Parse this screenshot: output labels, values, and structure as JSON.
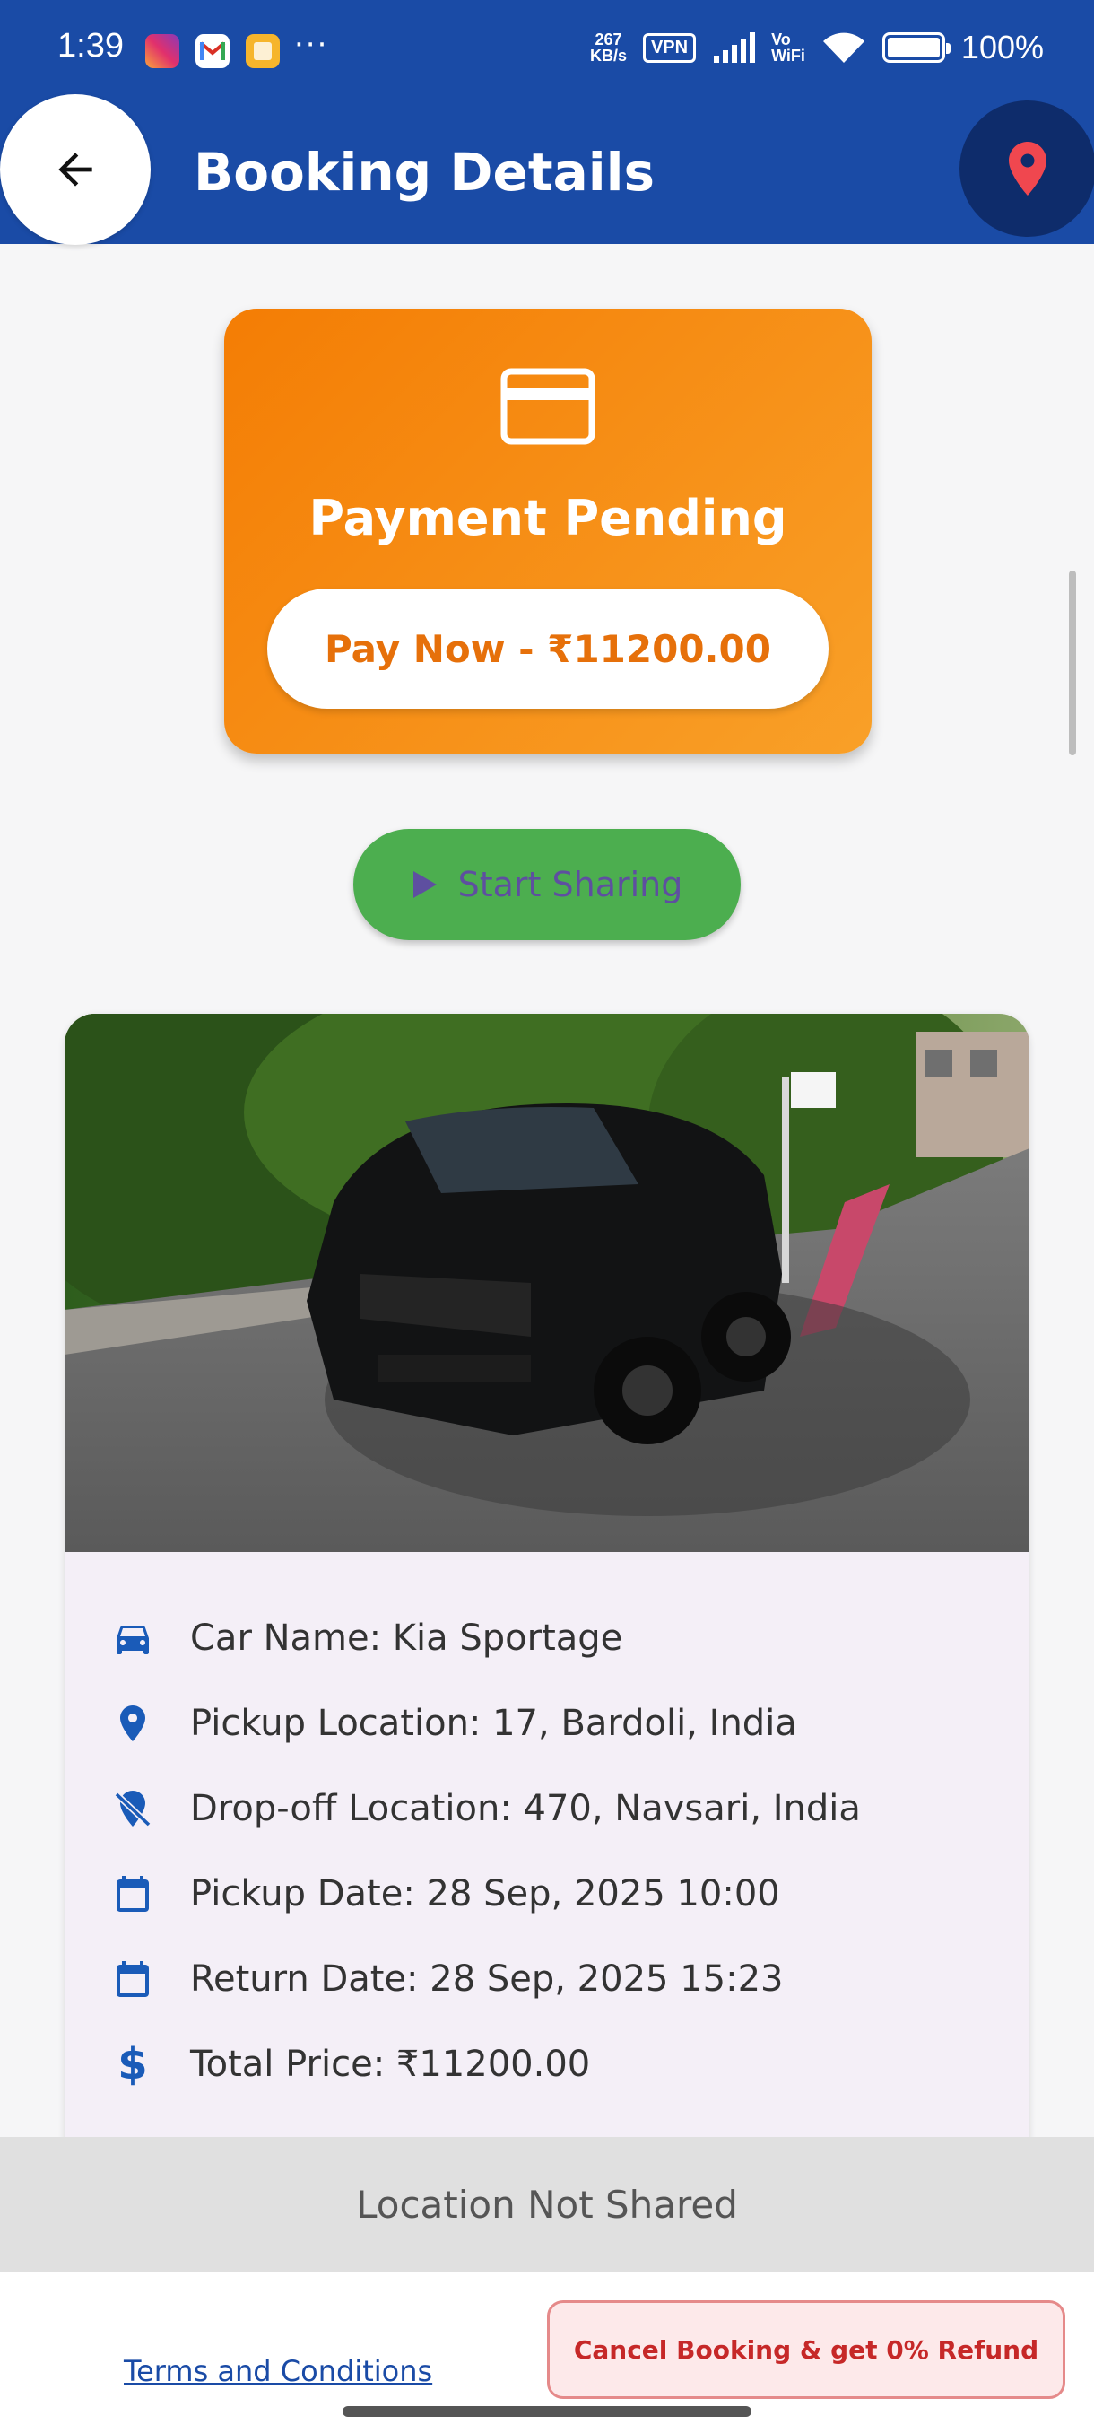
{
  "status_bar": {
    "time": "1:39",
    "more": "···",
    "net_speed_value": "267",
    "net_speed_unit": "KB/s",
    "vpn": "VPN",
    "vowifi_top": "Vo",
    "vowifi_bottom": "WiFi",
    "battery": "100%"
  },
  "header": {
    "title": "Booking Details",
    "color": "#1a4ba6",
    "location_pin_color": "#f0474f"
  },
  "payment": {
    "title": "Payment Pending",
    "button_label": "Pay Now - ₹11200.00"
  },
  "share": {
    "label": "Start Sharing"
  },
  "car": {
    "details": [
      {
        "icon": "car-icon",
        "text": "Car Name: Kia Sportage"
      },
      {
        "icon": "location-pin-icon",
        "text": "Pickup Location: 17, Bardoli, India"
      },
      {
        "icon": "location-off-icon",
        "text": "Drop-off Location: 470, Navsari, India"
      },
      {
        "icon": "calendar-icon",
        "text": "Pickup Date: 28 Sep, 2025 10:00"
      },
      {
        "icon": "calendar-icon",
        "text": "Return Date: 28 Sep, 2025 15:23"
      },
      {
        "icon": "dollar-icon",
        "text": "Total Price: ₹11200.00"
      }
    ]
  },
  "location_status": "Location Not Shared",
  "footer": {
    "terms": "Terms and Conditions",
    "cancel": "Cancel Booking & get 0% Refund"
  }
}
